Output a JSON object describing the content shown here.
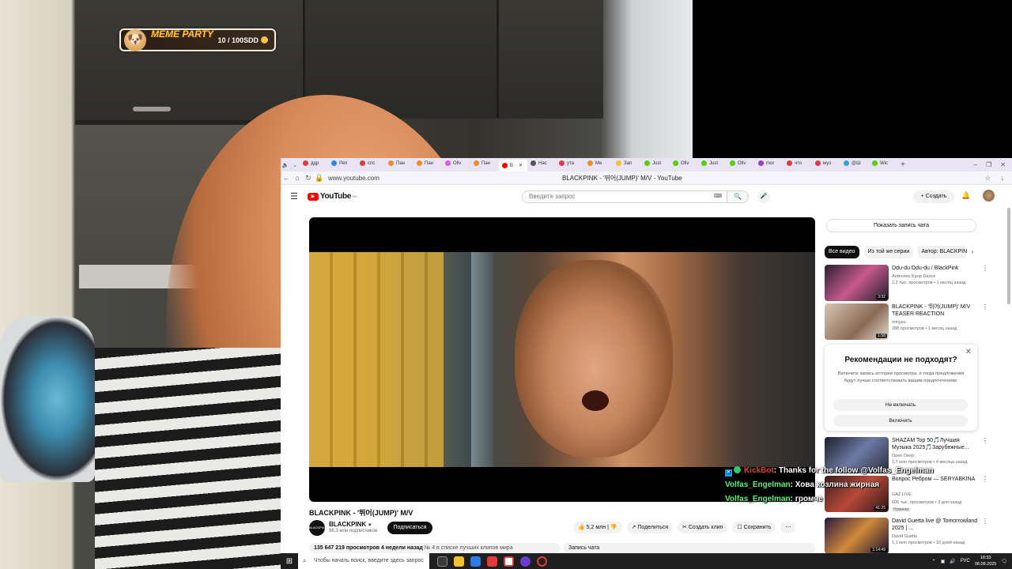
{
  "overlay": {
    "meme_title": "MEME PARTY",
    "meme_amount": "10 / 100SDD"
  },
  "browser": {
    "tabs": [
      {
        "label": "ддр",
        "color": "#e03a3a"
      },
      {
        "label": "Реп",
        "color": "#2a89e0"
      },
      {
        "label": "спс",
        "color": "#e03a3a"
      },
      {
        "label": "Пан",
        "color": "#f08a24"
      },
      {
        "label": "Пан",
        "color": "#f08a24"
      },
      {
        "label": "Oliv",
        "color": "#e05ae0"
      },
      {
        "label": "Пан",
        "color": "#f08a24"
      },
      {
        "label": "B",
        "color": "#ff0000",
        "active": true
      },
      {
        "label": "Нас",
        "color": "#555555"
      },
      {
        "label": "ута",
        "color": "#e03a3a"
      },
      {
        "label": "Ме",
        "color": "#f08a24"
      },
      {
        "label": "Зап",
        "color": "#f2c12e"
      },
      {
        "label": "Just",
        "color": "#53d000"
      },
      {
        "label": "Oliv",
        "color": "#53d000"
      },
      {
        "label": "Just",
        "color": "#53d000"
      },
      {
        "label": "Oliv",
        "color": "#53d000"
      },
      {
        "label": "mor",
        "color": "#9a3ad0"
      },
      {
        "label": "что",
        "color": "#e03a3a"
      },
      {
        "label": "муз",
        "color": "#e03a3a"
      },
      {
        "label": "@Ш",
        "color": "#2aa3e0"
      },
      {
        "label": "Wic",
        "color": "#53d000"
      }
    ],
    "url": "www.youtube.com",
    "page_title": "BLACKPINK - '뛰어(JUMP)' M/V - YouTube"
  },
  "youtube": {
    "logo_text": "YouTube",
    "logo_region": "RU",
    "search_placeholder": "Введите запрос",
    "create_label": "Создать",
    "video_title": "BLACKPINK - '뛰어(JUMP)' M/V",
    "channel_name": "BLACKPINK",
    "channel_avatar_text": "BLACKPINK",
    "subscribers": "96,3 млн подписчиков",
    "subscribe_label": "Подписаться",
    "likes": "5,2 млн",
    "share_label": "Поделиться",
    "clip_label": "Создать клип",
    "save_label": "Сохранить",
    "views": "135 647 219 просмотров",
    "date": "4 недели назад",
    "chart_rank": "№ 4 в списке лучших клипов мира",
    "chat_record": "Запись чата",
    "show_chat": "Показать запись чата",
    "chips": [
      "Все видео",
      "Из той же серии",
      "Автор: BLACKPINK"
    ],
    "recs": [
      {
        "title": "Ddu-du Ddu-du / BlackPink",
        "channel": "Ardennes Kpop Dance",
        "meta": "2,2 тыс. просмотров • 1 месяц назад",
        "duration": "3:32",
        "thumb": "linear-gradient(135deg,#2a2030,#c65a8a 50%,#1e1e2a)"
      },
      {
        "title": "BLACKPINK - '뛰어(JUMP)' M/V TEASER REACTION",
        "channel": "minyeu",
        "meta": "288 просмотров • 1 месяц назад",
        "duration": "1:58",
        "thumb": "linear-gradient(135deg,#d8c6b4,#8a6a55 60%,#e7ddd2)"
      },
      {
        "title": "SHAZAM Top 50🎵Лучшая Музыка 2025🎵Зарубежные...",
        "channel": "Open Deep",
        "meta": "1,7 млн просмотров • 4 месяца назад",
        "duration": "",
        "thumb": "linear-gradient(135deg,#1d1e2c,#6d7aa6 50%,#2a2b3a)"
      },
      {
        "title": "Вопрос Ребром — SERYABKINA",
        "channel": "GAZ LIVE",
        "meta": "606 тыс. просмотров • 3 дня назад",
        "badge": "Новинка",
        "duration": "41:25",
        "thumb": "linear-gradient(135deg,#3a1c1c,#b84a3a 50%,#2a1414)"
      },
      {
        "title": "David Guetta live @ Tomorrowland 2025 | ...",
        "channel": "David Guetta",
        "meta": "1,1 млн просмотров • 10 дней назад",
        "duration": "1:14:49",
        "thumb": "linear-gradient(135deg,#2a1a40,#d08a3a 50%,#1a1030)"
      }
    ],
    "popup": {
      "title": "Рекомендации не подходят?",
      "text": "Включите запись истории просмотра, и тогда предложения будут лучше соответствовать вашим предпочтениям.",
      "btn_off": "Не включать",
      "btn_on": "Включить"
    }
  },
  "chat": [
    {
      "user": "KickBot",
      "text": ": Thanks for the follow @Volfas_Engelman"
    },
    {
      "user": "Volfas_Engelman",
      "text": ": Хова козлина жирная"
    },
    {
      "user": "Volfas_Engelman",
      "text": ": громче"
    }
  ],
  "taskbar": {
    "search_placeholder": "Чтобы начать поиск, введите здесь запрос",
    "lang": "РУС",
    "time": "18:33",
    "date": "08.08.2025"
  }
}
